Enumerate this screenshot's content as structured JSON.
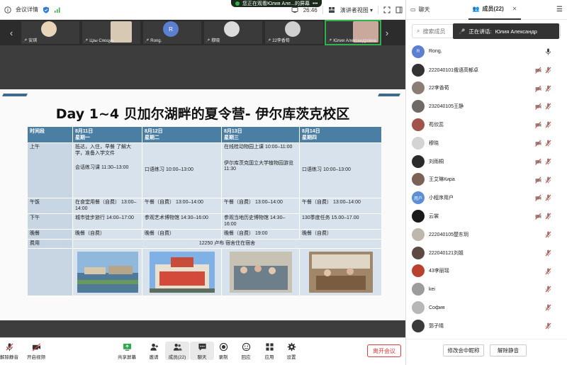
{
  "topbar": {
    "meeting_details": "会议详情",
    "banner_text": "您正在观看Юлия Але...的屏幕",
    "time": "26:46",
    "view_mode": "演讲者视图"
  },
  "strip": {
    "tiles": [
      {
        "name": "安琪",
        "color": "#e8d4b8"
      },
      {
        "name": "Цзы Сяоцун",
        "color": "#d8c9b5"
      },
      {
        "name": "Rong.",
        "color": "#5b7fd1"
      },
      {
        "name": "穆晓",
        "color": "#dcdcdc"
      },
      {
        "name": "22李香荀",
        "color": "#cfcfcf"
      },
      {
        "name": "Юлия Александровна",
        "color": "#c9a99b"
      }
    ]
  },
  "slide": {
    "title": "Day 1~4 贝加尔湖畔的夏令营- 伊尔库茨克校区",
    "headers": [
      {
        "l1": "时间段",
        "l2": ""
      },
      {
        "l1": "8月11日",
        "l2": "星期一"
      },
      {
        "l1": "8月12日",
        "l2": "星期二"
      },
      {
        "l1": "8月13日",
        "l2": "星期三"
      },
      {
        "l1": "8月14日",
        "l2": "星期四"
      }
    ],
    "rows": {
      "morning": {
        "label": "上午",
        "d1a": "抵达，入住，早餐 了解大学，准备入学文件",
        "d1b": "会话练习课 11:30–13:00",
        "d2": "口语练习 10:00–13:00",
        "d3a": "在线桂动物园上课 10:00–11:00",
        "d3b": "伊尔库茨克国立大学植物园游览 11:30",
        "d4": "口语练习 10:00–13:00"
      },
      "lunch": {
        "label": "午饭",
        "d1": "在食堂用餐（自费） 13:00–14:00",
        "d2": "午餐（自费） 13:00–14:00",
        "d3": "午餐（自费） 13:00–14:00",
        "d4": "午餐（自费） 13:00–14:00"
      },
      "afternoon": {
        "label": "下午",
        "d1": "城市徒步旅行 14:00–17:00",
        "d2": "参观艺术博物馆 14:30–16:00",
        "d3": "参观当地历史博物馆 14:30–16:00",
        "d4": "130季度任务 15.00–17.00"
      },
      "dinner": {
        "label": "晚餐",
        "d1": "晚餐（自费）",
        "d2": "晚餐（自费）",
        "d3": "晚餐（自费） 19:00",
        "d4": "晚餐（自费）"
      },
      "fee": {
        "label": "费用",
        "text": "12250 卢布   宿舍住在宿舍"
      }
    }
  },
  "toolbar": {
    "mute": "解除静音",
    "video": "开启视频",
    "share": "共享屏幕",
    "invite": "邀请",
    "members": "成员(22)",
    "chat": "聊天",
    "record": "录制",
    "reactions": "回应",
    "apps": "应用",
    "settings": "设置",
    "leave": "离开会议"
  },
  "panel": {
    "tab_chat": "聊天",
    "tab_members": "成员(22)",
    "search_placeholder": "搜索成员",
    "speaking_label": "正在讲话:",
    "speaking_name": "Юлия Александр",
    "members": [
      {
        "name": "Rong.",
        "avatar": "R",
        "color": "#5b7fd1",
        "mic": "on"
      },
      {
        "name": "222040101俄语高郁卓",
        "avatar": "",
        "color": "#333",
        "mic": "muted"
      },
      {
        "name": "22李香荀",
        "avatar": "",
        "color": "#8a7d73",
        "mic": "muted"
      },
      {
        "name": "232040105王静",
        "avatar": "",
        "color": "#6f6a66",
        "mic": "muted"
      },
      {
        "name": "苟欣蕊",
        "avatar": "",
        "color": "#a0524b",
        "mic": "muted"
      },
      {
        "name": "穆晓",
        "avatar": "",
        "color": "#d4d4d4",
        "mic": "muted"
      },
      {
        "name": "刘雨桐",
        "avatar": "",
        "color": "#2b2b2b",
        "mic": "muted"
      },
      {
        "name": "王艾琳Кира",
        "avatar": "",
        "color": "#7a6256",
        "mic": "muted"
      },
      {
        "name": "小程序用户",
        "avatar": "用户",
        "color": "#5b8ed6",
        "mic": "muted"
      },
      {
        "name": "云裳",
        "avatar": "",
        "color": "#1a1a1a",
        "mic": "muted"
      },
      {
        "name": "222040105楚东玥",
        "avatar": "",
        "color": "#bfb6ad",
        "mic": "muted"
      },
      {
        "name": "222040121刘姐",
        "avatar": "",
        "color": "#5c4a42",
        "mic": "muted"
      },
      {
        "name": "43李丽瑶",
        "avatar": "",
        "color": "#b8412f",
        "mic": "muted"
      },
      {
        "name": "kei",
        "avatar": "",
        "color": "#9c9c9c",
        "mic": "muted"
      },
      {
        "name": "София",
        "avatar": "",
        "color": "#b7b7b7",
        "mic": "muted"
      },
      {
        "name": "郭子晴",
        "avatar": "",
        "color": "#3a3a3a",
        "mic": "muted"
      }
    ],
    "rename_button": "修改会中昵称",
    "unmute_button": "解除静音"
  }
}
